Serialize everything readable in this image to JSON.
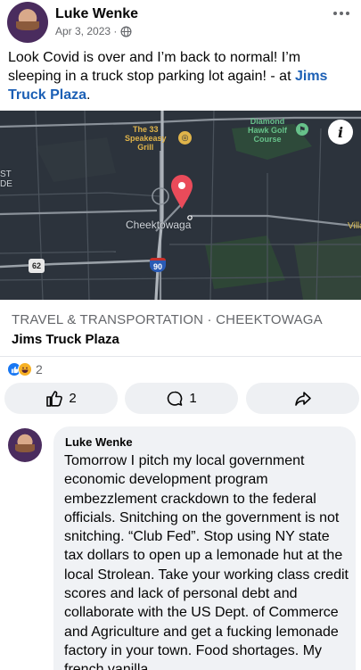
{
  "post": {
    "author": "Luke Wenke",
    "date": "Apr 3, 2023 ·",
    "privacy_icon": "globe-icon",
    "text_main": "Look Covid is over and I’m back to normal!  I’m sleeping in a truck stop parking lot again! - at ",
    "location_link": "Jims Truck Plaza",
    "text_end": "."
  },
  "map": {
    "labels": {
      "city": "Cheektowaga",
      "left_1": "ST",
      "left_2": "DE",
      "speakeasy_1": "The 33",
      "speakeasy_2": "Speakeasy",
      "speakeasy_3": "Grill",
      "golf_1": "Diamond",
      "golf_2": "Hawk Golf",
      "golf_3": "Course",
      "right_edge": "Villa",
      "route_62": "62",
      "route_90": "90"
    },
    "colors": {
      "background": "#2c333c",
      "pin": "#ea4b5a",
      "road": "#8a9199",
      "highway": "#aeb4bb"
    }
  },
  "place": {
    "category": "TRAVEL & TRANSPORTATION · CHEEKTOWAGA",
    "name": "Jims Truck Plaza"
  },
  "reactions": {
    "count": "2",
    "types": [
      "like",
      "haha"
    ]
  },
  "actions": {
    "like_count": "2",
    "comment_count": "1"
  },
  "comment": {
    "author": "Luke Wenke",
    "text": "Tomorrow I pitch my local government economic development program embezzlement crackdown to the federal officials.  Snitching on the government is not snitching.  “Club Fed”.  Stop using NY state tax dollars to open up a lemonade hut at the local Strolean.  Take your working class credit scores and lack of personal debt and collaborate with the US Dept. of Commerce and Agriculture and get a fucking lemonade factory in your town.  Food shortages.  My french vanilla"
  }
}
